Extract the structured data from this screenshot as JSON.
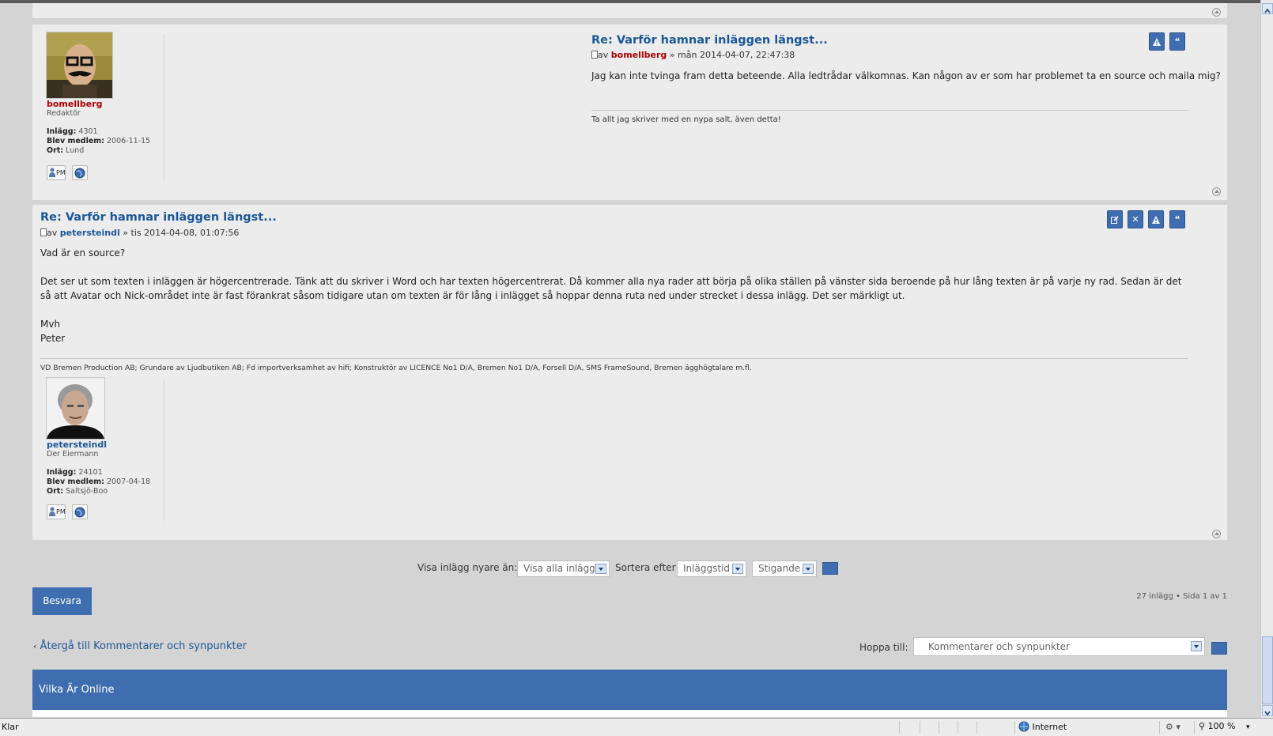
{
  "posts": [
    {
      "title": "Re: Varför hamnar inläggen längst...",
      "meta_prefix": "av",
      "author": "bomellberg",
      "meta_sep": "»",
      "date": "mån 2014-04-07, 22:47:38",
      "body": [
        "Jag kan inte tvinga fram detta beteende. Alla ledtrådar välkomnas. Kan någon av er som har problemet ta en source och maila mig?"
      ],
      "signature": "Ta allt jag skriver med en nypa salt, även detta!",
      "profile": {
        "name": "bomellberg",
        "rank": "Redaktör",
        "posts_label": "Inlägg:",
        "posts": "4301",
        "joined_label": "Blev medlem:",
        "joined": "2006-11-15",
        "location_label": "Ort:",
        "location": "Lund",
        "pm_label": "PM"
      }
    },
    {
      "title": "Re: Varför hamnar inläggen längst...",
      "meta_prefix": "av",
      "author": "petersteindl",
      "meta_sep": "»",
      "date": "tis 2014-04-08, 01:07:56",
      "body": [
        "Vad är en source?",
        "Det ser ut som texten i inläggen är högercentrerade. Tänk att du skriver i Word och har texten högercentrerat. Då kommer alla nya rader att börja på olika ställen på vänster sida beroende på hur lång texten är på varje ny rad. Sedan är det så att Avatar och Nick-området inte är fast förankrat såsom tidigare utan om texten är för lång i inlägget så hoppar denna ruta ned under strecket i dessa inlägg. Det ser märkligt ut.",
        "Mvh",
        "Peter"
      ],
      "signature": "VD Bremen Production AB; Grundare av Ljudbutiken AB; Fd importverksamhet av hifi; Konstruktör av LICENCE No1 D/A, Bremen No1 D/A, Forsell D/A, SMS FrameSound, Bremen ägghögtalare m.fl.",
      "profile": {
        "name": "petersteindl",
        "rank": "Der Eiermann",
        "posts_label": "Inlägg:",
        "posts": "24101",
        "joined_label": "Blev medlem:",
        "joined": "2007-04-18",
        "location_label": "Ort:",
        "location": "Saltsjö-Boo",
        "pm_label": "PM"
      }
    }
  ],
  "colors": {
    "accent": "#3f6eb0",
    "title_link": "#1a5797",
    "moderator_name": "#aa0000",
    "user_name": "#1a5797"
  },
  "filters": {
    "show_label": "Visa inlägg nyare än:",
    "show_value": "Visa alla inlägg",
    "sort_label": "Sortera efter",
    "sort_value": "Inläggstid",
    "order_value": "Stigande"
  },
  "reply_button": "Besvara",
  "pagination": "27 inlägg • Sida 1 av 1",
  "back_link": "Återgå till Kommentarer och synpunkter",
  "jump": {
    "label": "Hoppa till:",
    "value": "Kommentarer och synpunkter"
  },
  "online_heading": "Vilka Är Online",
  "statusbar": {
    "status": "Klar",
    "zone": "Internet",
    "zoom": "100 %"
  }
}
